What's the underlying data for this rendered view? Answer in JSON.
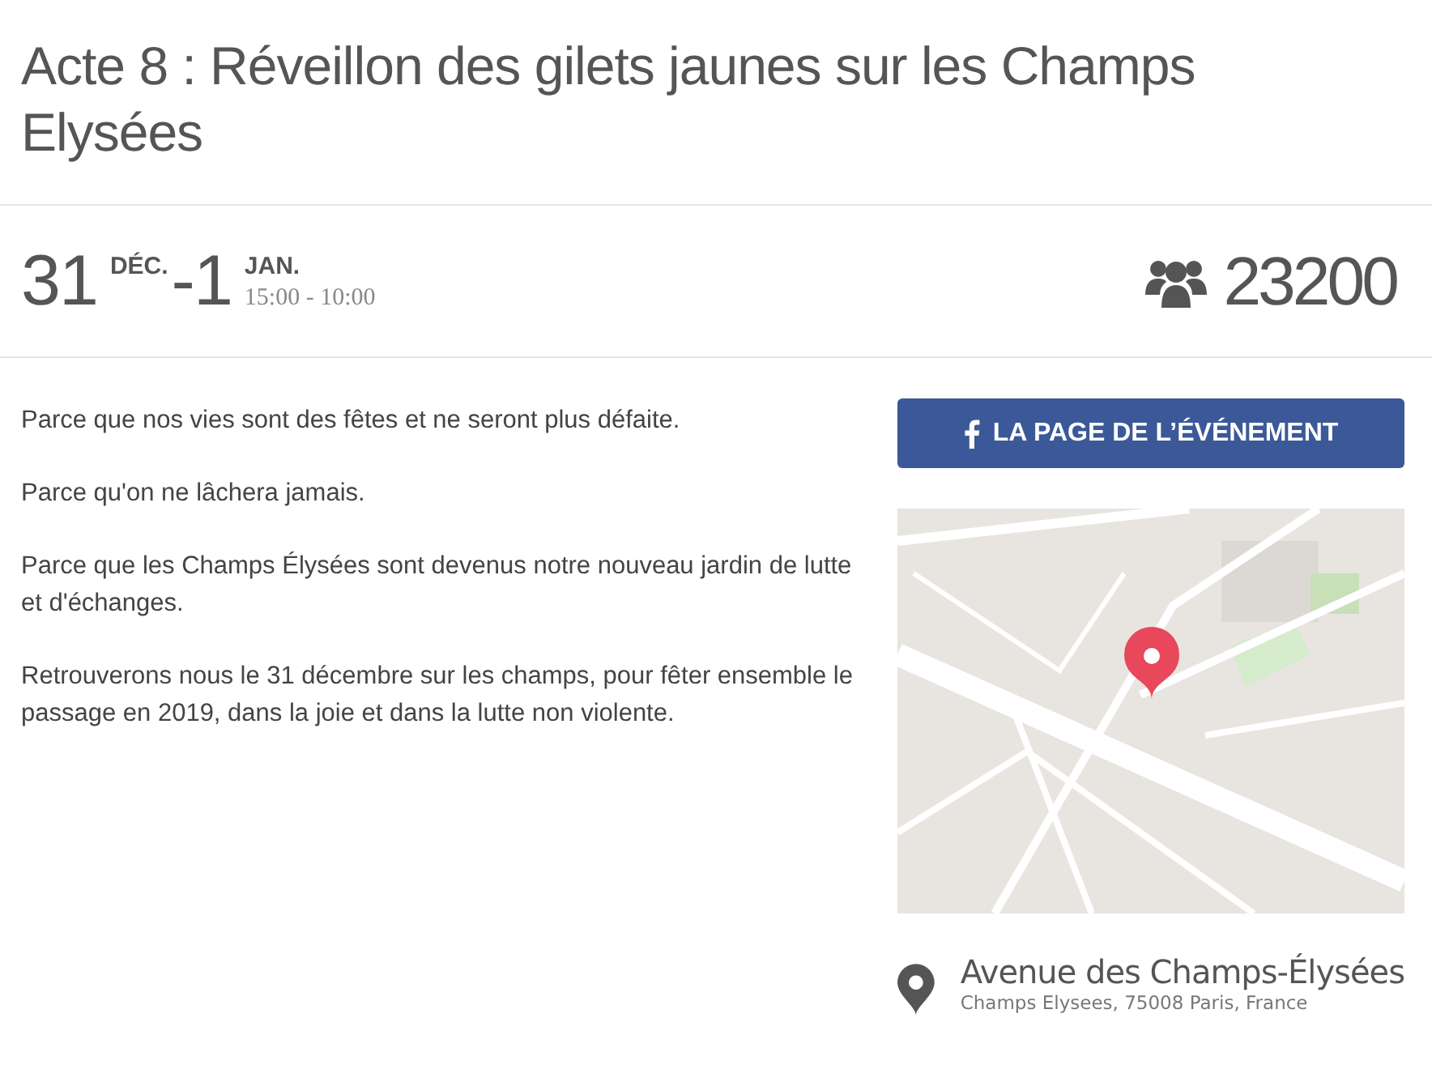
{
  "title": "Acte 8 : Réveillon des gilets jaunes sur les Champs Elysées",
  "date": {
    "start_day": "31",
    "start_month": "DÉC.",
    "end_day": "-1",
    "end_month": "JAN.",
    "time": "15:00 - 10:00"
  },
  "attendees": "23200",
  "description": [
    "Parce que nos vies sont des fêtes et ne seront plus défaite.",
    "Parce qu'on ne lâchera jamais.",
    "Parce que les Champs Élysées sont devenus notre nouveau jardin de lutte et d'échanges.",
    "Retrouverons nous le 31 décembre sur les champs, pour fêter ensemble le passage en 2019, dans la joie et dans la lutte non violente."
  ],
  "event_button": "LA PAGE DE L’ÉVÉNEMENT",
  "location": {
    "name": "Avenue des Champs-Élysées",
    "address": "Champs Elysees, 75008 Paris, France"
  }
}
